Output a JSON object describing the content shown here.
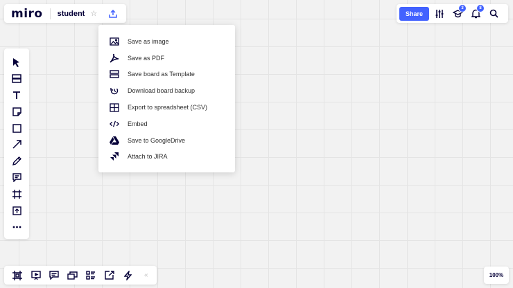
{
  "header": {
    "logo": "miro",
    "board_name": "student",
    "star": "☆",
    "share_label": "Share",
    "badges": {
      "learning": "3",
      "notifications": "8"
    }
  },
  "export_menu": {
    "items": [
      {
        "label": "Save as image",
        "icon": "image-icon"
      },
      {
        "label": "Save as PDF",
        "icon": "pdf-icon"
      },
      {
        "label": "Save board as Template",
        "icon": "template-icon"
      },
      {
        "label": "Download board backup",
        "icon": "backup-icon"
      },
      {
        "label": "Export to spreadsheet (CSV)",
        "icon": "spreadsheet-icon"
      },
      {
        "label": "Embed",
        "icon": "embed-icon"
      },
      {
        "label": "Save to GoogleDrive",
        "icon": "google-drive-icon"
      },
      {
        "label": "Attach to JIRA",
        "icon": "jira-icon"
      }
    ]
  },
  "left_toolbar": {
    "tools": [
      "select-tool",
      "templates-tool",
      "text-tool",
      "sticky-note-tool",
      "shape-tool",
      "connection-line-tool",
      "pen-tool",
      "comment-tool",
      "frame-tool",
      "upload-tool",
      "more-tools"
    ]
  },
  "bottom_toolbar": {
    "tools": [
      "frames",
      "presentation",
      "comments",
      "cards",
      "board-overview",
      "screen-share",
      "activity"
    ],
    "collapse": "«"
  },
  "zoom": {
    "level": "100%"
  },
  "colors": {
    "accent": "#4262ff",
    "ink": "#050038",
    "canvas": "#f2f2f2"
  }
}
